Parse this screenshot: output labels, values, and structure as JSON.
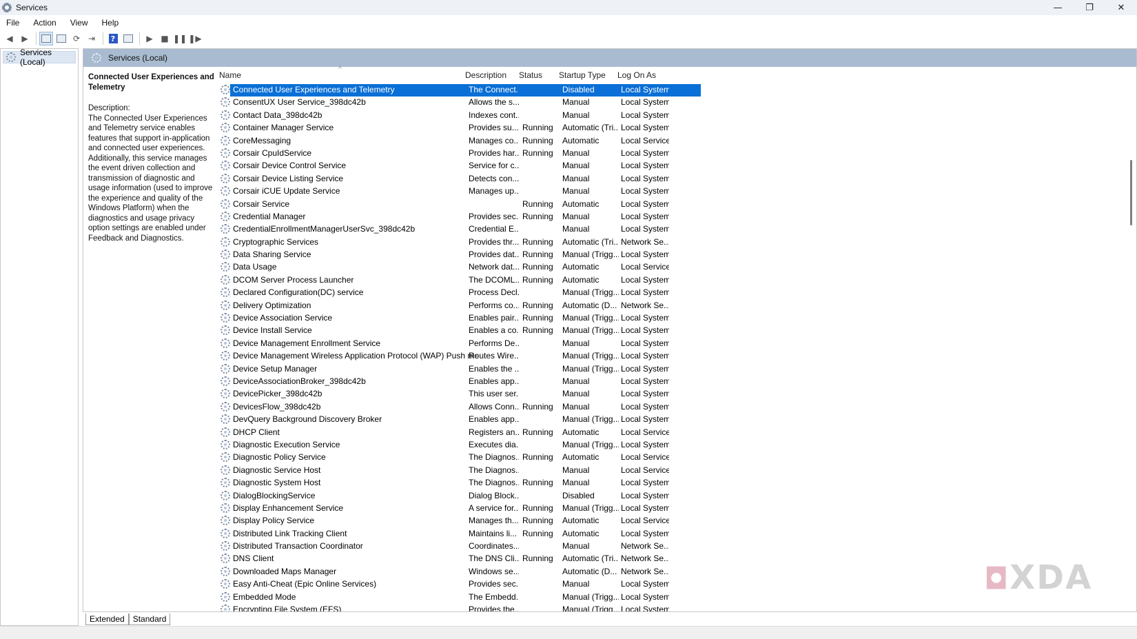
{
  "window": {
    "title": "Services"
  },
  "window_controls": {
    "minimize": "—",
    "restore": "❐",
    "close": "✕"
  },
  "menu": [
    "File",
    "Action",
    "View",
    "Help"
  ],
  "tree": {
    "root_label": "Services (Local)"
  },
  "panel": {
    "header": "Services (Local)",
    "selected_title": "Connected User Experiences and Telemetry",
    "description_label": "Description:",
    "description_text": "The Connected User Experiences and Telemetry service enables features that support in-application and connected user experiences. Additionally, this service manages the event driven collection and transmission of diagnostic and usage information (used to improve the experience and quality of the Windows Platform) when the diagnostics and usage privacy option settings are enabled under Feedback and Diagnostics."
  },
  "columns": {
    "name": "Name",
    "description": "Description",
    "status": "Status",
    "startup": "Startup Type",
    "logon": "Log On As"
  },
  "rows": [
    {
      "name": "Connected User Experiences and Telemetry",
      "description": "The Connect...",
      "status": "",
      "startup": "Disabled",
      "logon": "Local System"
    },
    {
      "name": "ConsentUX User Service_398dc42b",
      "description": "Allows the s...",
      "status": "",
      "startup": "Manual",
      "logon": "Local System"
    },
    {
      "name": "Contact Data_398dc42b",
      "description": "Indexes cont...",
      "status": "",
      "startup": "Manual",
      "logon": "Local System"
    },
    {
      "name": "Container Manager Service",
      "description": "Provides su...",
      "status": "Running",
      "startup": "Automatic (Tri...",
      "logon": "Local System"
    },
    {
      "name": "CoreMessaging",
      "description": "Manages co...",
      "status": "Running",
      "startup": "Automatic",
      "logon": "Local Service"
    },
    {
      "name": "Corsair CpuIdService",
      "description": "Provides har...",
      "status": "Running",
      "startup": "Manual",
      "logon": "Local System"
    },
    {
      "name": "Corsair Device Control Service",
      "description": "Service for c...",
      "status": "",
      "startup": "Manual",
      "logon": "Local System"
    },
    {
      "name": "Corsair Device Listing Service",
      "description": "Detects con...",
      "status": "",
      "startup": "Manual",
      "logon": "Local System"
    },
    {
      "name": "Corsair iCUE Update Service",
      "description": "Manages up...",
      "status": "",
      "startup": "Manual",
      "logon": "Local System"
    },
    {
      "name": "Corsair Service",
      "description": "",
      "status": "Running",
      "startup": "Automatic",
      "logon": "Local System"
    },
    {
      "name": "Credential Manager",
      "description": "Provides sec...",
      "status": "Running",
      "startup": "Manual",
      "logon": "Local System"
    },
    {
      "name": "CredentialEnrollmentManagerUserSvc_398dc42b",
      "description": "Credential E...",
      "status": "",
      "startup": "Manual",
      "logon": "Local System"
    },
    {
      "name": "Cryptographic Services",
      "description": "Provides thr...",
      "status": "Running",
      "startup": "Automatic (Tri...",
      "logon": "Network Se..."
    },
    {
      "name": "Data Sharing Service",
      "description": "Provides dat...",
      "status": "Running",
      "startup": "Manual (Trigg...",
      "logon": "Local System"
    },
    {
      "name": "Data Usage",
      "description": "Network dat...",
      "status": "Running",
      "startup": "Automatic",
      "logon": "Local Service"
    },
    {
      "name": "DCOM Server Process Launcher",
      "description": "The DCOML...",
      "status": "Running",
      "startup": "Automatic",
      "logon": "Local System"
    },
    {
      "name": "Declared Configuration(DC) service",
      "description": "Process Decl...",
      "status": "",
      "startup": "Manual (Trigg...",
      "logon": "Local System"
    },
    {
      "name": "Delivery Optimization",
      "description": "Performs co...",
      "status": "Running",
      "startup": "Automatic (D...",
      "logon": "Network Se..."
    },
    {
      "name": "Device Association Service",
      "description": "Enables pair...",
      "status": "Running",
      "startup": "Manual (Trigg...",
      "logon": "Local System"
    },
    {
      "name": "Device Install Service",
      "description": "Enables a co...",
      "status": "Running",
      "startup": "Manual (Trigg...",
      "logon": "Local System"
    },
    {
      "name": "Device Management Enrollment Service",
      "description": "Performs De...",
      "status": "",
      "startup": "Manual",
      "logon": "Local System"
    },
    {
      "name": "Device Management Wireless Application Protocol (WAP) Push messa...",
      "description": "Routes Wire...",
      "status": "",
      "startup": "Manual (Trigg...",
      "logon": "Local System"
    },
    {
      "name": "Device Setup Manager",
      "description": "Enables the ...",
      "status": "",
      "startup": "Manual (Trigg...",
      "logon": "Local System"
    },
    {
      "name": "DeviceAssociationBroker_398dc42b",
      "description": "Enables app...",
      "status": "",
      "startup": "Manual",
      "logon": "Local System"
    },
    {
      "name": "DevicePicker_398dc42b",
      "description": "This user ser...",
      "status": "",
      "startup": "Manual",
      "logon": "Local System"
    },
    {
      "name": "DevicesFlow_398dc42b",
      "description": "Allows Conn...",
      "status": "Running",
      "startup": "Manual",
      "logon": "Local System"
    },
    {
      "name": "DevQuery Background Discovery Broker",
      "description": "Enables app...",
      "status": "",
      "startup": "Manual (Trigg...",
      "logon": "Local System"
    },
    {
      "name": "DHCP Client",
      "description": "Registers an...",
      "status": "Running",
      "startup": "Automatic",
      "logon": "Local Service"
    },
    {
      "name": "Diagnostic Execution Service",
      "description": "Executes dia...",
      "status": "",
      "startup": "Manual (Trigg...",
      "logon": "Local System"
    },
    {
      "name": "Diagnostic Policy Service",
      "description": "The Diagnos...",
      "status": "Running",
      "startup": "Automatic",
      "logon": "Local Service"
    },
    {
      "name": "Diagnostic Service Host",
      "description": "The Diagnos...",
      "status": "",
      "startup": "Manual",
      "logon": "Local Service"
    },
    {
      "name": "Diagnostic System Host",
      "description": "The Diagnos...",
      "status": "Running",
      "startup": "Manual",
      "logon": "Local System"
    },
    {
      "name": "DialogBlockingService",
      "description": "Dialog Block...",
      "status": "",
      "startup": "Disabled",
      "logon": "Local System"
    },
    {
      "name": "Display Enhancement Service",
      "description": "A service for...",
      "status": "Running",
      "startup": "Manual (Trigg...",
      "logon": "Local System"
    },
    {
      "name": "Display Policy Service",
      "description": "Manages th...",
      "status": "Running",
      "startup": "Automatic",
      "logon": "Local Service"
    },
    {
      "name": "Distributed Link Tracking Client",
      "description": "Maintains li...",
      "status": "Running",
      "startup": "Automatic",
      "logon": "Local System"
    },
    {
      "name": "Distributed Transaction Coordinator",
      "description": "Coordinates...",
      "status": "",
      "startup": "Manual",
      "logon": "Network Se..."
    },
    {
      "name": "DNS Client",
      "description": "The DNS Cli...",
      "status": "Running",
      "startup": "Automatic (Tri...",
      "logon": "Network Se..."
    },
    {
      "name": "Downloaded Maps Manager",
      "description": "Windows se...",
      "status": "",
      "startup": "Automatic (D...",
      "logon": "Network Se..."
    },
    {
      "name": "Easy Anti-Cheat (Epic Online Services)",
      "description": "Provides sec...",
      "status": "",
      "startup": "Manual",
      "logon": "Local System"
    },
    {
      "name": "Embedded Mode",
      "description": "The Embedd...",
      "status": "",
      "startup": "Manual (Trigg...",
      "logon": "Local System"
    },
    {
      "name": "Encrypting File System (EFS)",
      "description": "Provides the...",
      "status": "",
      "startup": "Manual (Trigg...",
      "logon": "Local System"
    }
  ],
  "tabs": [
    "Extended",
    "Standard"
  ],
  "watermark": {
    "mark": "◘",
    "text": "XDA"
  }
}
